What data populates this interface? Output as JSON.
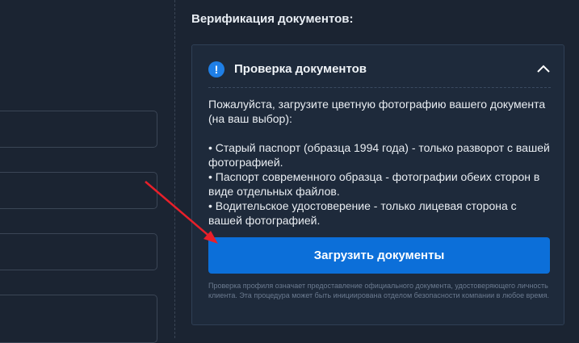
{
  "section": {
    "title": "Верификация документов:"
  },
  "card": {
    "title": "Проверка документов",
    "intro": "Пожалуйста, загрузите цветную фотографию вашего документа (на ваш выбор):",
    "bullets": [
      "• Старый паспорт (образца 1994 года) - только разворот с вашей фотографией.",
      "• Паспорт современного образца - фотографии обеих сторон в виде отдельных файлов.",
      "• Водительское удостоверение - только лицевая сторона с вашей фотографией."
    ],
    "upload_label": "Загрузить документы",
    "footnote": "Проверка профиля означает предоставление официального документа, удостоверяющего личность клиента. Эта процедура может быть инициирована отделом безопасности компании в любое время."
  },
  "icons": {
    "info": "info-icon",
    "collapse": "chevron-up-icon",
    "annotation": "red-arrow"
  },
  "colors": {
    "background": "#1b2432",
    "card": "#1e2a3b",
    "accent": "#0c6fd9",
    "info_icon": "#1f7fe6",
    "arrow": "#e8202a",
    "muted_text": "#6b7a8f"
  }
}
